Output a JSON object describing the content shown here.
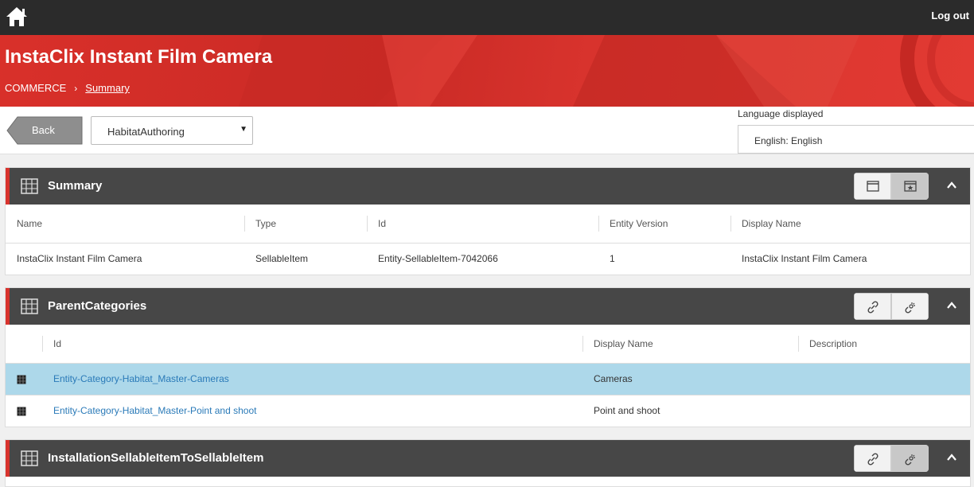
{
  "topbar": {
    "logout_label": "Log out"
  },
  "header": {
    "title": "InstaClix Instant Film Camera",
    "breadcrumb_root": "COMMERCE",
    "breadcrumb_current": "Summary"
  },
  "toolbar": {
    "back_label": "Back",
    "environment_value": "HabitatAuthoring",
    "language_label": "Language displayed",
    "language_value": "English: English"
  },
  "summary": {
    "title": "Summary",
    "columns": [
      "Name",
      "Type",
      "Id",
      "Entity Version",
      "Display Name"
    ],
    "row": [
      "InstaClix Instant Film Camera",
      "SellableItem",
      "Entity-SellableItem-7042066",
      "1",
      "InstaClix Instant Film Camera"
    ]
  },
  "parent_categories": {
    "title": "ParentCategories",
    "columns": [
      "Id",
      "Display Name",
      "Description"
    ],
    "rows": [
      {
        "id": "Entity-Category-Habitat_Master-Cameras",
        "display_name": "Cameras",
        "description": ""
      },
      {
        "id": "Entity-Category-Habitat_Master-Point and shoot",
        "display_name": "Point and shoot",
        "description": ""
      }
    ]
  },
  "installation": {
    "title": "InstallationSellableItemToSellableItem"
  },
  "colors": {
    "accent": "#d8332d",
    "panel_header": "#474747",
    "selected_row": "#add8ea",
    "link": "#2a7ab8"
  }
}
